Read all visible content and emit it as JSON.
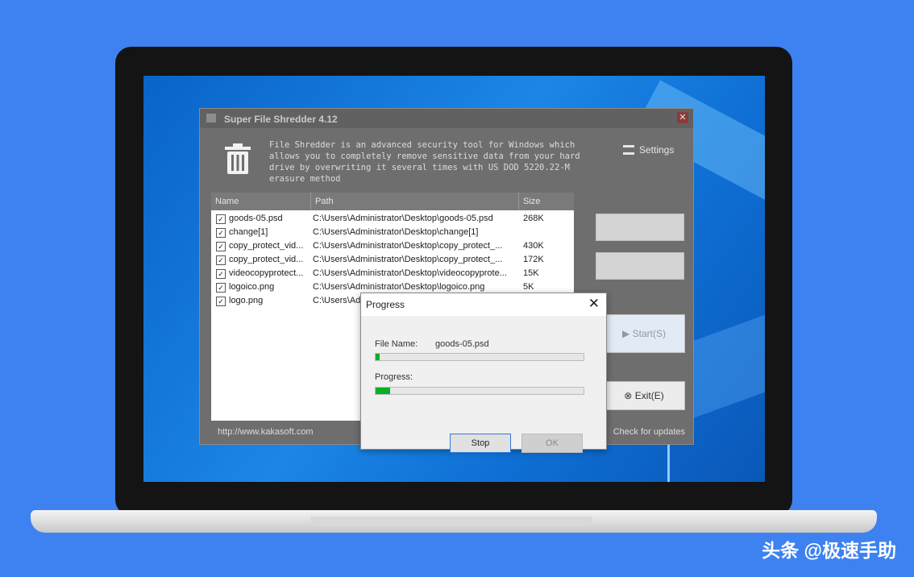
{
  "app": {
    "title": "Super File Shredder 4.12",
    "description": "File Shredder is an advanced security tool for Windows which allows you to completely remove sensitive data from your hard drive by overwriting it several times with US DOD 5220.22-M erasure method",
    "settings_label": "Settings",
    "columns": [
      "Name",
      "Path",
      "Size"
    ],
    "files": [
      {
        "name": "goods-05.psd",
        "path": "C:\\Users\\Administrator\\Desktop\\goods-05.psd",
        "size": "268K"
      },
      {
        "name": "change[1]",
        "path": "C:\\Users\\Administrator\\Desktop\\change[1]",
        "size": ""
      },
      {
        "name": "copy_protect_vid...",
        "path": "C:\\Users\\Administrator\\Desktop\\copy_protect_...",
        "size": "430K"
      },
      {
        "name": "copy_protect_vid...",
        "path": "C:\\Users\\Administrator\\Desktop\\copy_protect_...",
        "size": "172K"
      },
      {
        "name": "videocopyprotect...",
        "path": "C:\\Users\\Administrator\\Desktop\\videocopyprote...",
        "size": "15K"
      },
      {
        "name": "logoico.png",
        "path": "C:\\Users\\Administrator\\Desktop\\logoico.png",
        "size": "5K"
      },
      {
        "name": "logo.png",
        "path": "C:\\Users\\Ad",
        "size": ""
      }
    ],
    "start_label": "Start(S)",
    "exit_label": "Exit(E)",
    "website": "http://www.kakasoft.com",
    "check_updates": "Check for updates"
  },
  "dialog": {
    "title": "Progress",
    "file_name_label": "File Name:",
    "file_name_value": "goods-05.psd",
    "file_progress": 0.02,
    "progress_label": "Progress:",
    "overall_progress": 0.07,
    "stop_label": "Stop",
    "ok_label": "OK"
  },
  "watermark": "头条 @极速手助"
}
